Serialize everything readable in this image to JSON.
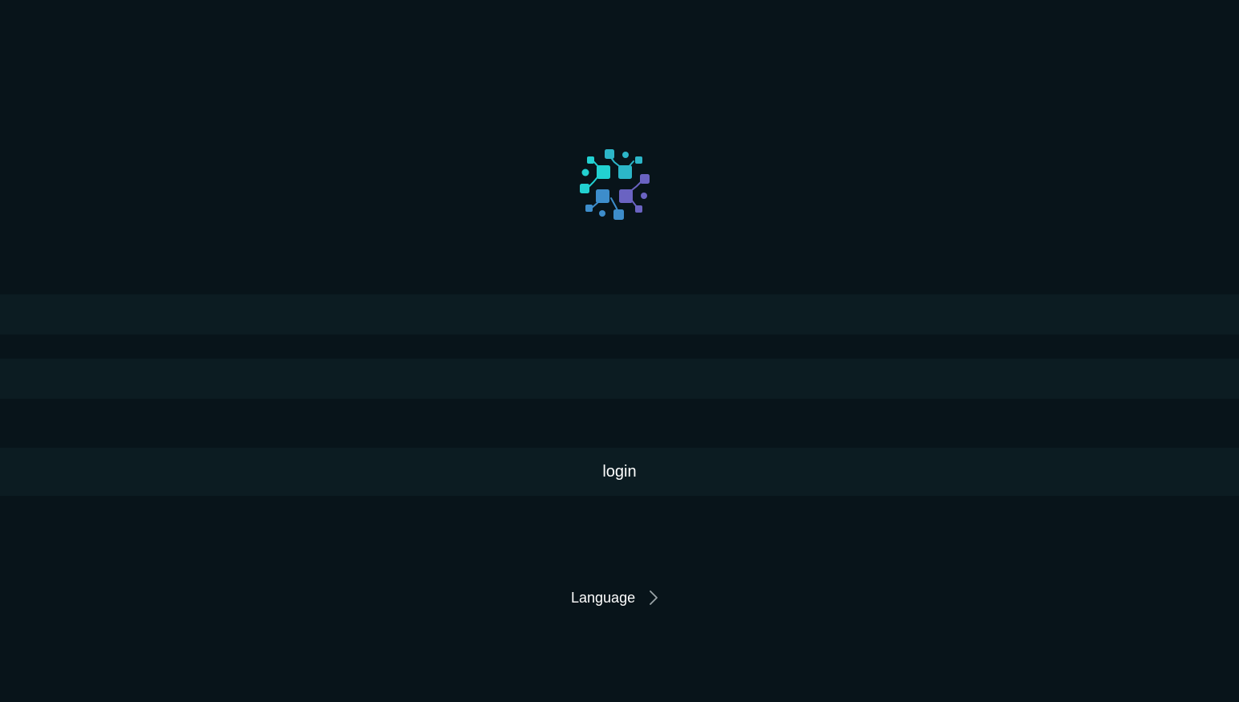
{
  "login_form": {
    "username": {
      "value": "",
      "placeholder": ""
    },
    "password": {
      "value": "",
      "placeholder": ""
    },
    "login_label": "login"
  },
  "language_selector": {
    "label": "Language",
    "icon": "chevron-right-icon"
  },
  "brand": {
    "logo_icon": "network-nodes-logo-icon",
    "colors": {
      "background": "#08141a",
      "field_background": "#0c1c22",
      "teal": "#22d1d1",
      "cyan": "#2cb6c8",
      "blue": "#3d8dcb",
      "purple": "#6a63c2"
    }
  }
}
